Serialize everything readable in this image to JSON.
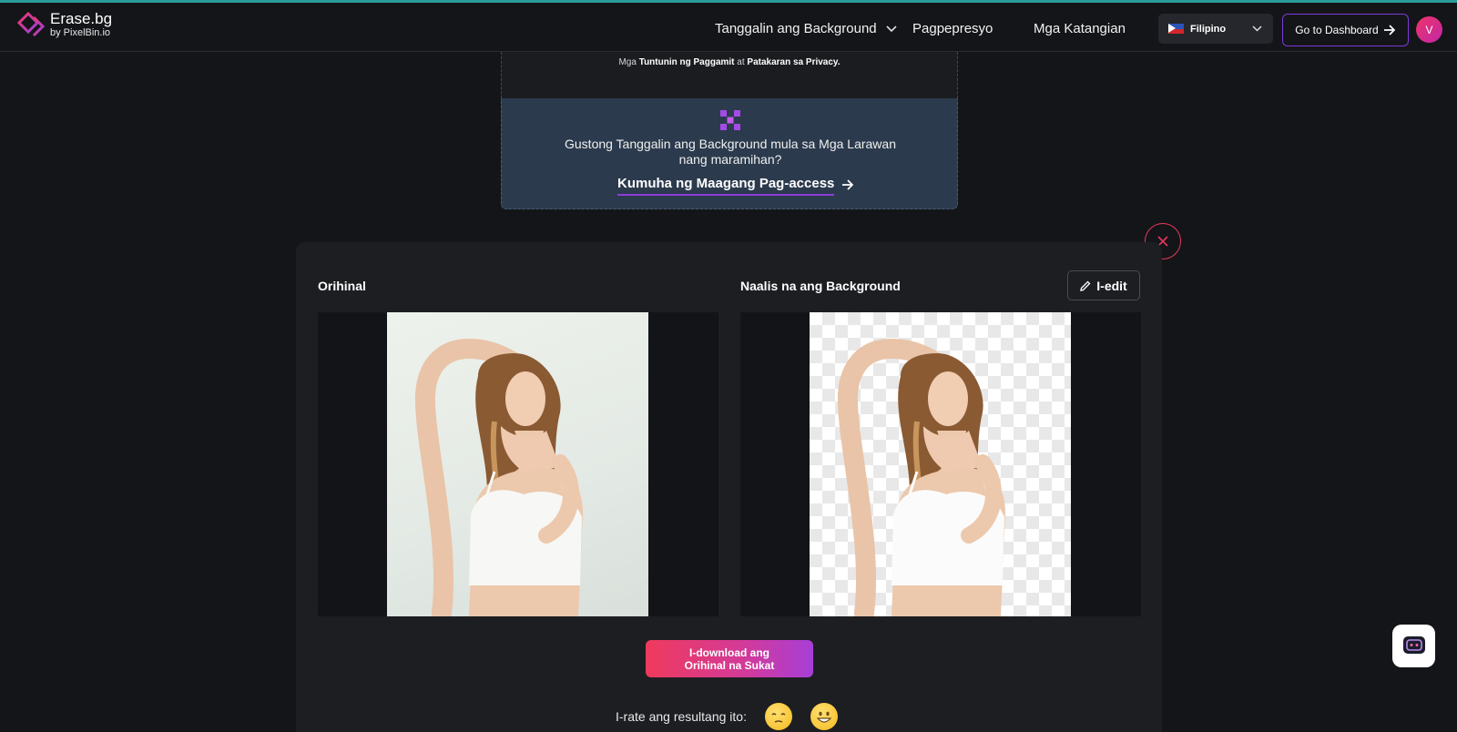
{
  "nav": {
    "brand_title": "Erase.bg",
    "brand_sub": "by PixelBin.io",
    "links": [
      "Tanggalin ang Background",
      "Pagpepresyo",
      "Mga Katangian"
    ],
    "language": "Filipino",
    "dashboard_label": "Go to Dashboard",
    "avatar_initial": "V"
  },
  "upload": {
    "terms_prefix": "Mga",
    "terms_link": "Tuntunin ng Paggamit",
    "terms_and": "at",
    "privacy_link": "Patakaran sa Privacy."
  },
  "bulk": {
    "text": "Gustong Tanggalin ang Background mula sa Mga Larawan nang maramihan?",
    "link": "Kumuha ng Maagang Pag-access"
  },
  "result": {
    "original_label": "Orihinal",
    "removed_label": "Naalis na ang Background",
    "edit_label": "I-edit",
    "download_label": "I-download ang Orihinal na Sukat",
    "rate_label": "I-rate ang resultang ito:"
  },
  "colors": {
    "accent_purple": "#7b3bd6",
    "accent_pink": "#ef3a5d",
    "background": "#141518",
    "bulk_bg": "#2b3a4d"
  },
  "icons": [
    "logo-mark-icon",
    "chevron-down-icon",
    "arrow-right-icon",
    "bulk-grid-icon",
    "close-icon",
    "pencil-icon",
    "unamused-emoji-icon",
    "grinning-emoji-icon",
    "chat-icon"
  ]
}
